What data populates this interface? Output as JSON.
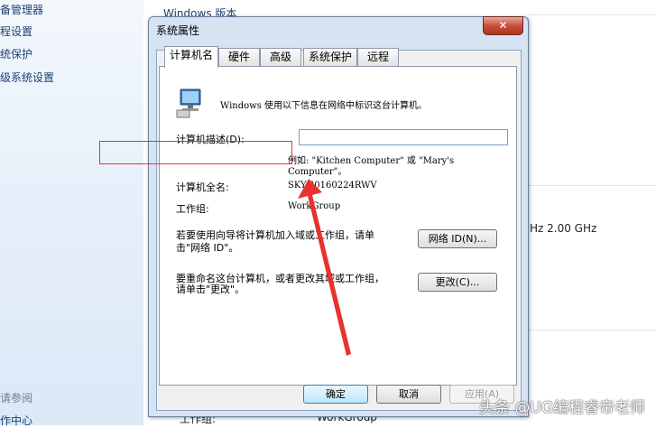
{
  "left_nav": {
    "items": [
      "备管理器",
      "程设置",
      "统保护",
      "级系统设置"
    ],
    "see_also": "请参阅",
    "bottom": "作中心"
  },
  "background": {
    "windows_version": "Windows 版本",
    "cpu_speed": "Hz   2.00 GHz",
    "workgroup_label": "工作组:",
    "workgroup_value": "WorkGroup"
  },
  "dialog": {
    "title": "系统属性",
    "close": "✕",
    "tabs": [
      "计算机名",
      "硬件",
      "高级",
      "系统保护",
      "远程"
    ],
    "intro": "Windows 使用以下信息在网络中标识这台计算机。",
    "description_label": "计算机描述(D):",
    "description_value": "",
    "example_line1": "例如: \"Kitchen Computer\" 或 \"Mary's",
    "example_line2": "Computer\"。",
    "fullname_label": "计算机全名:",
    "fullname_value": "SKY-20160224RWV",
    "workgroup_label": "工作组:",
    "workgroup_value": "WorkGroup",
    "network_text_line1": "若要使用向导将计算机加入域或工作组，请单",
    "network_text_line2": "击\"网络 ID\"。",
    "network_button": "网络 ID(N)...",
    "rename_text_line1": "要重命名这台计算机，或者更改其域或工作组，",
    "rename_text_line2": "请单击\"更改\"。",
    "change_button": "更改(C)...",
    "ok_button": "确定",
    "cancel_button": "取消",
    "apply_button": "应用(A)"
  },
  "watermark": "头条 @UG编程睿帝老师",
  "colors": {
    "highlight": "#e8322c",
    "arrow": "#e8322c",
    "dialog_frame": "#d6e3f3"
  }
}
